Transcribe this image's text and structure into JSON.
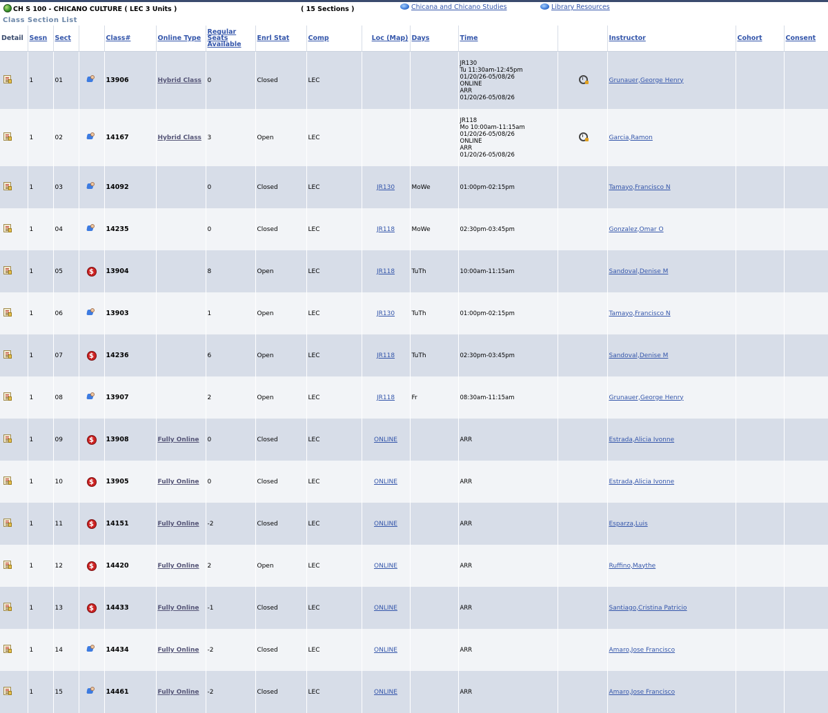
{
  "header": {
    "course_title": "CH S 100 - CHICANO CULTURE ( LEC  3 Units )",
    "sections_count": "( 15 Sections )",
    "link1": "Chicana and Chicano Studies",
    "link2": "Library Resources",
    "subtitle": "Class Section List"
  },
  "columns": {
    "detail": "Detail",
    "sesn": "Sesn",
    "sect": "Sect",
    "class_num": "Class#",
    "online_type": "Online Type",
    "seats": "Regular Seats Available",
    "enrl_stat": "Enrl Stat",
    "comp": "Comp",
    "loc": "Loc (Map)",
    "days": "Days",
    "time": "Time",
    "instructor": "Instructor",
    "cohort": "Cohort",
    "consent": "Consent"
  },
  "rows": [
    {
      "sesn": "1",
      "sect": "01",
      "icon": "person-icon",
      "class_num": "13906",
      "online_type": "Hybrid Class",
      "seats": "0",
      "enrl_stat": "Closed",
      "comp": "LEC",
      "loc": "",
      "days": "",
      "time": "JR130\nTu 11:30am-12:45pm\n01/20/26-05/08/26\nONLINE\nARR\n01/20/26-05/08/26",
      "clock": true,
      "instructor": "Grunauer,George Henry"
    },
    {
      "sesn": "1",
      "sect": "02",
      "icon": "person-icon",
      "class_num": "14167",
      "online_type": "Hybrid Class",
      "seats": "3",
      "enrl_stat": "Open",
      "comp": "LEC",
      "loc": "",
      "days": "",
      "time": "JR118\nMo 10:00am-11:15am\n01/20/26-05/08/26\nONLINE\nARR\n01/20/26-05/08/26",
      "clock": true,
      "instructor": "Garcia,Ramon"
    },
    {
      "sesn": "1",
      "sect": "03",
      "icon": "person-icon",
      "class_num": "14092",
      "online_type": "",
      "seats": "0",
      "enrl_stat": "Closed",
      "comp": "LEC",
      "loc": "JR130",
      "days": "MoWe",
      "time": "01:00pm-02:15pm",
      "clock": false,
      "instructor": "Tamayo,Francisco N"
    },
    {
      "sesn": "1",
      "sect": "04",
      "icon": "person-icon",
      "class_num": "14235",
      "online_type": "",
      "seats": "0",
      "enrl_stat": "Closed",
      "comp": "LEC",
      "loc": "JR118",
      "days": "MoWe",
      "time": "02:30pm-03:45pm",
      "clock": false,
      "instructor": "Gonzalez,Omar O"
    },
    {
      "sesn": "1",
      "sect": "05",
      "icon": "dollar-icon",
      "class_num": "13904",
      "online_type": "",
      "seats": "8",
      "enrl_stat": "Open",
      "comp": "LEC",
      "loc": "JR118",
      "days": "TuTh",
      "time": "10:00am-11:15am",
      "clock": false,
      "instructor": "Sandoval,Denise M"
    },
    {
      "sesn": "1",
      "sect": "06",
      "icon": "person-icon",
      "class_num": "13903",
      "online_type": "",
      "seats": "1",
      "enrl_stat": "Open",
      "comp": "LEC",
      "loc": "JR130",
      "days": "TuTh",
      "time": "01:00pm-02:15pm",
      "clock": false,
      "instructor": "Tamayo,Francisco N"
    },
    {
      "sesn": "1",
      "sect": "07",
      "icon": "dollar-icon",
      "class_num": "14236",
      "online_type": "",
      "seats": "6",
      "enrl_stat": "Open",
      "comp": "LEC",
      "loc": "JR118",
      "days": "TuTh",
      "time": "02:30pm-03:45pm",
      "clock": false,
      "instructor": "Sandoval,Denise M"
    },
    {
      "sesn": "1",
      "sect": "08",
      "icon": "person-icon",
      "class_num": "13907",
      "online_type": "",
      "seats": "2",
      "enrl_stat": "Open",
      "comp": "LEC",
      "loc": "JR118",
      "days": "Fr",
      "time": "08:30am-11:15am",
      "clock": false,
      "instructor": "Grunauer,George Henry"
    },
    {
      "sesn": "1",
      "sect": "09",
      "icon": "dollar-icon",
      "class_num": "13908",
      "online_type": "Fully Online",
      "seats": "0",
      "enrl_stat": "Closed",
      "comp": "LEC",
      "loc": "ONLINE",
      "days": "",
      "time": "ARR",
      "clock": false,
      "instructor": "Estrada,Alicia Ivonne"
    },
    {
      "sesn": "1",
      "sect": "10",
      "icon": "dollar-icon",
      "class_num": "13905",
      "online_type": "Fully Online",
      "seats": "0",
      "enrl_stat": "Closed",
      "comp": "LEC",
      "loc": "ONLINE",
      "days": "",
      "time": "ARR",
      "clock": false,
      "instructor": "Estrada,Alicia Ivonne"
    },
    {
      "sesn": "1",
      "sect": "11",
      "icon": "dollar-icon",
      "class_num": "14151",
      "online_type": "Fully Online",
      "seats": "-2",
      "enrl_stat": "Closed",
      "comp": "LEC",
      "loc": "ONLINE",
      "days": "",
      "time": "ARR",
      "clock": false,
      "instructor": "Esparza,Luis"
    },
    {
      "sesn": "1",
      "sect": "12",
      "icon": "dollar-icon",
      "class_num": "14420",
      "online_type": "Fully Online",
      "seats": "2",
      "enrl_stat": "Open",
      "comp": "LEC",
      "loc": "ONLINE",
      "days": "",
      "time": "ARR",
      "clock": false,
      "instructor": "Ruffino,Maythe"
    },
    {
      "sesn": "1",
      "sect": "13",
      "icon": "dollar-icon",
      "class_num": "14433",
      "online_type": "Fully Online",
      "seats": "-1",
      "enrl_stat": "Closed",
      "comp": "LEC",
      "loc": "ONLINE",
      "days": "",
      "time": "ARR",
      "clock": false,
      "instructor": "Santiago,Cristina Patricio"
    },
    {
      "sesn": "1",
      "sect": "14",
      "icon": "person-icon",
      "class_num": "14434",
      "online_type": "Fully Online",
      "seats": "-2",
      "enrl_stat": "Closed",
      "comp": "LEC",
      "loc": "ONLINE",
      "days": "",
      "time": "ARR",
      "clock": false,
      "instructor": "Amaro,Jose Francisco"
    },
    {
      "sesn": "1",
      "sect": "15",
      "icon": "person-icon",
      "class_num": "14461",
      "online_type": "Fully Online",
      "seats": "-2",
      "enrl_stat": "Closed",
      "comp": "LEC",
      "loc": "ONLINE",
      "days": "",
      "time": "ARR",
      "clock": false,
      "instructor": "Amaro,Jose Francisco"
    }
  ]
}
